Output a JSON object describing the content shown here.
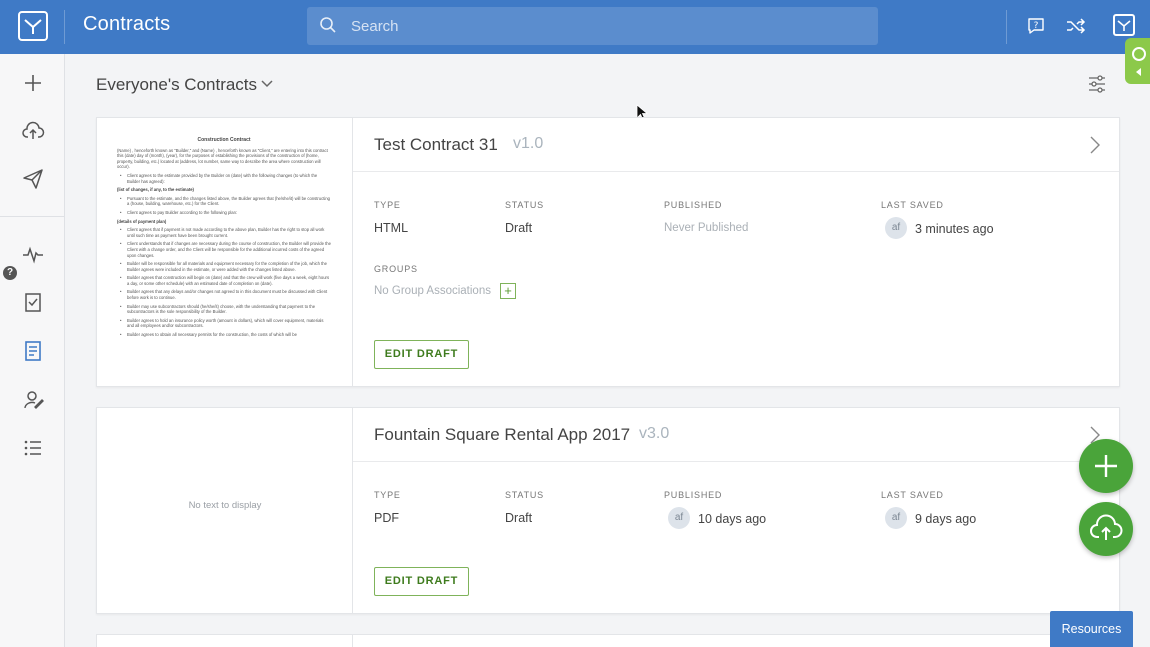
{
  "header": {
    "app_title": "Contracts",
    "search_placeholder": "Search",
    "icons": [
      "logo-icon",
      "search-icon",
      "help-icon",
      "shuffle-icon",
      "apps-icon"
    ]
  },
  "rail": {
    "items": [
      {
        "name": "new",
        "icon": "plus-icon"
      },
      {
        "name": "upload",
        "icon": "cloud-upload-icon"
      },
      {
        "name": "send",
        "icon": "paper-plane-icon"
      },
      {
        "name": "activity",
        "icon": "pulse-icon"
      },
      {
        "name": "tasks",
        "icon": "checklist-icon"
      },
      {
        "name": "contracts",
        "icon": "document-icon",
        "active": true
      },
      {
        "name": "signers",
        "icon": "user-sign-icon"
      },
      {
        "name": "list",
        "icon": "list-icon"
      }
    ],
    "help_badge": "?"
  },
  "main": {
    "filter_title": "Everyone's Contracts"
  },
  "contracts": [
    {
      "name": "Test Contract 31",
      "version": "v1.0",
      "type_label": "TYPE",
      "type": "HTML",
      "status_label": "STATUS",
      "status": "Draft",
      "published_label": "PUBLISHED",
      "published": "Never Published",
      "last_saved_label": "LAST SAVED",
      "last_saved_avatar": "af",
      "last_saved": "3 minutes ago",
      "groups_label": "GROUPS",
      "groups": "No Group Associations",
      "add_group": "+",
      "action": "EDIT DRAFT",
      "preview": {
        "title": "Construction Contract",
        "intro": "(Name) , henceforth known as \"Builder,\" and (Name) , henceforth known as \"Client,\" are entering into this contract this (date) day of (month), (year), for the purposes of establishing the provisions of the construction of (home, property, building, etc.) located at (address, lot number, same way to describe the area where construction will occur).",
        "b1": "Client agrees to the estimate provided by the Builder on (date) with the following changes (to which the Builder has agreed):",
        "h1": "(list of changes, if any, to the estimate)",
        "b2": "Pursuant to the estimate, and the changes listed above, the Builder agrees that (he/she/it) will be constructing a (house, building, warehouse, etc.) for the Client.",
        "b3": "Client agrees to pay Builder according to the following plan:",
        "h2": "(details of payment plan)",
        "b4": "Client agrees that if payment is not made according to the above plan, Builder has the right to stop all work until such time as payment have been brought current.",
        "b5": "Client understands that if changes are necessary during the course of construction, the Builder will provide the Client with a change order, and the Client will be responsible for the additional incurred costs of the agreed upon changes.",
        "b6": "Builder will be responsible for all materials and equipment necessary for the completion of the job, which the Builder agrees were included in the estimate, or were added with the changes listed above.",
        "b7": "Builder agrees that construction will begin on (date) and that the crew will work (five days a week, eight hours a day, or some other schedule) with an estimated date of completion on (date).",
        "b8": "Builder agrees that any delays and/or changes not agreed to in this document must be discussed with Client before work is to continue.",
        "b9": "Builder may use subcontractors should (he/she/it) choose, with the understanding that payment to the subcontractors is the sole responsibility of the Builder.",
        "b10": "Builder agrees to hold an insurance policy worth (amount in dollars), which will cover equipment, materials and all employees and/or subcontractors.",
        "b11": "Builder agrees to obtain all necessary permits for the construction, the costs of which will be"
      }
    },
    {
      "name": "Fountain Square Rental App 2017",
      "version": "v3.0",
      "type_label": "TYPE",
      "type": "PDF",
      "status_label": "STATUS",
      "status": "Draft",
      "published_label": "PUBLISHED",
      "published_avatar": "af",
      "published": "10 days ago",
      "last_saved_label": "LAST SAVED",
      "last_saved_avatar": "af",
      "last_saved": "9 days ago",
      "action": "EDIT DRAFT",
      "preview_empty": "No text to display"
    }
  ],
  "fab": {
    "primary_icon": "plus-icon",
    "secondary_icon": "cloud-upload-icon",
    "color": "#4aa43a"
  },
  "resources_label": "Resources",
  "colors": {
    "header": "#3f7ac6",
    "accent_green": "#4aa43a",
    "extension_tab": "#8cc94a"
  }
}
